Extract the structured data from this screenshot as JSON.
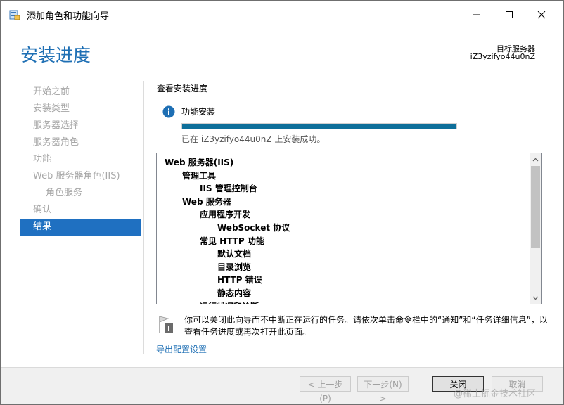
{
  "window": {
    "title": "添加角色和功能向导"
  },
  "header": {
    "title": "安装进度",
    "target_label": "目标服务器",
    "target_name": "iZ3yzifyo44u0nZ"
  },
  "nav": {
    "items": [
      {
        "label": "开始之前",
        "sub": false,
        "active": false
      },
      {
        "label": "安装类型",
        "sub": false,
        "active": false
      },
      {
        "label": "服务器选择",
        "sub": false,
        "active": false
      },
      {
        "label": "服务器角色",
        "sub": false,
        "active": false
      },
      {
        "label": "功能",
        "sub": false,
        "active": false
      },
      {
        "label": "Web 服务器角色(IIS)",
        "sub": false,
        "active": false
      },
      {
        "label": "角色服务",
        "sub": true,
        "active": false
      },
      {
        "label": "确认",
        "sub": false,
        "active": false
      },
      {
        "label": "结果",
        "sub": false,
        "active": true
      }
    ]
  },
  "main": {
    "section_heading": "查看安装进度",
    "feature_label": "功能安装",
    "progress": 1.0,
    "status_text": "已在 iZ3yzifyo44u0nZ 上安装成功。",
    "tree": [
      {
        "label": "Web 服务器(IIS)",
        "level": 0
      },
      {
        "label": "管理工具",
        "level": 1
      },
      {
        "label": "IIS 管理控制台",
        "level": 2
      },
      {
        "label": "Web 服务器",
        "level": 1
      },
      {
        "label": "应用程序开发",
        "level": 2
      },
      {
        "label": "WebSocket 协议",
        "level": 3
      },
      {
        "label": "常见 HTTP 功能",
        "level": 2
      },
      {
        "label": "默认文档",
        "level": 3
      },
      {
        "label": "目录浏览",
        "level": 3
      },
      {
        "label": "HTTP 错误",
        "level": 3
      },
      {
        "label": "静态内容",
        "level": 3
      },
      {
        "label": "运行状况和诊断",
        "level": 2
      }
    ],
    "note": "你可以关闭此向导而不中断正在运行的任务。请依次单击命令栏中的“通知”和“任务详细信息”，以查看任务进度或再次打开此页面。",
    "export_link": "导出配置设置"
  },
  "footer": {
    "prev": "< 上一步(P)",
    "next": "下一步(N) >",
    "close": "关闭",
    "cancel": "取消"
  },
  "watermark": "@稀土掘金技术社区",
  "colors": {
    "accent": "#1e6fb4",
    "nav_active": "#1f70c1",
    "progress": "#0e6f9a"
  }
}
